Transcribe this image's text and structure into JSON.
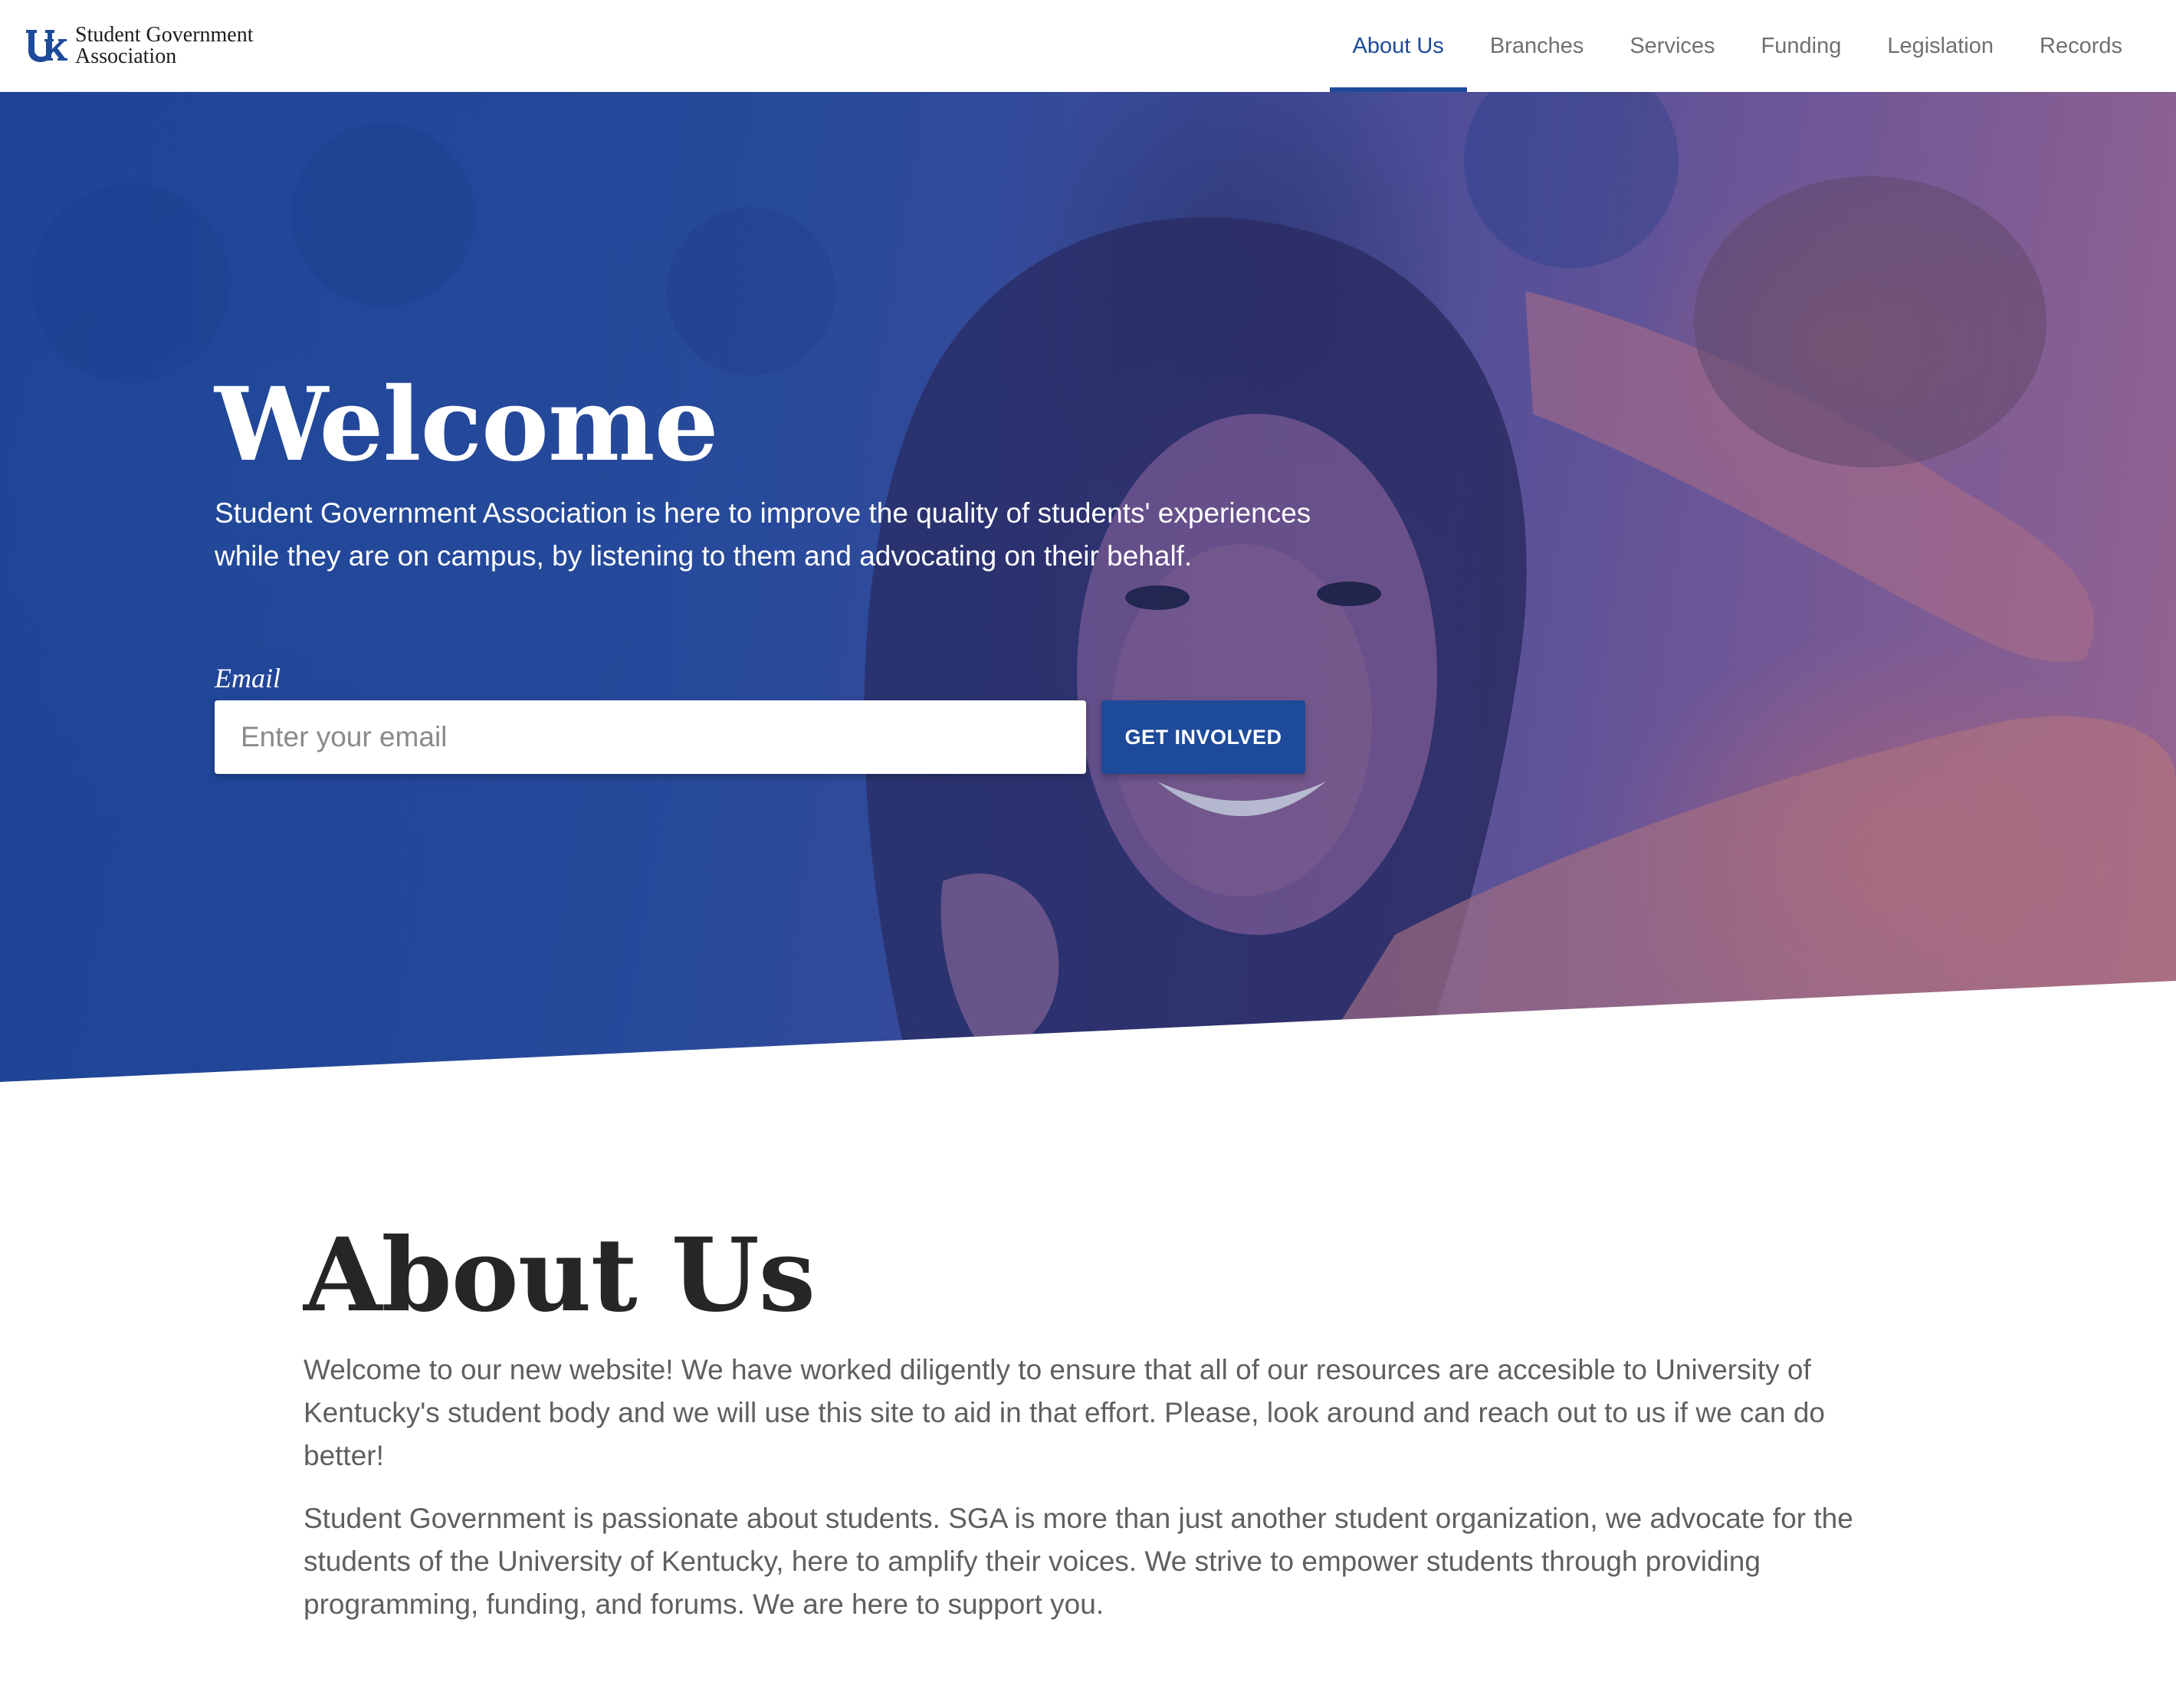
{
  "header": {
    "brand": {
      "logo_icon": "uk-logo",
      "line1": "Student Government",
      "line2": "Association"
    },
    "nav": [
      {
        "label": "About Us",
        "active": true
      },
      {
        "label": "Branches",
        "active": false
      },
      {
        "label": "Services",
        "active": false
      },
      {
        "label": "Funding",
        "active": false
      },
      {
        "label": "Legislation",
        "active": false
      },
      {
        "label": "Records",
        "active": false
      }
    ]
  },
  "hero": {
    "title": "Welcome",
    "subtitle": "Student Government Association is here to improve the quality of students' experiences while they are on campus, by listening to them and advocating on their behalf.",
    "email_label": "Email",
    "email_placeholder": "Enter your email",
    "email_value": "",
    "button_label": "GET INVOLVED"
  },
  "about": {
    "title": "About Us",
    "paragraphs": [
      "Welcome to our new website! We have worked diligently to ensure that all of our resources are accesible to University of Kentucky's student body and we will use this site to aid in that effort. Please, look around and reach out to us if we can do better!",
      "Student Government is passionate about students. SGA is more than just another student organization, we advocate for the students of the University of Kentucky, here to amplify their voices. We strive to empower students through providing programming, funding, and forums. We are here to support you."
    ]
  },
  "colors": {
    "brand_blue": "#1e4a9a",
    "nav_inactive": "#707070",
    "heading_dark": "#262626",
    "body_text": "#5f5f5f"
  }
}
